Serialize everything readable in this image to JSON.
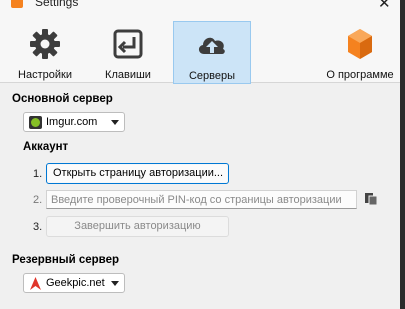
{
  "window": {
    "title": "Settings",
    "close_glyph": "✕"
  },
  "toolbar": {
    "items": [
      {
        "label": "Настройки",
        "icon": "gear-icon",
        "active": false
      },
      {
        "label": "Клавиши",
        "icon": "keyboard-return-icon",
        "active": false
      },
      {
        "label": "Серверы",
        "icon": "cloud-upload-icon",
        "active": true
      },
      {
        "label": "О программе",
        "icon": "app-logo-icon",
        "active": false
      }
    ]
  },
  "main_server": {
    "title": "Основной сервер",
    "selected": "Imgur.com",
    "icon": "imgur-icon"
  },
  "account": {
    "title": "Аккаунт",
    "steps": [
      {
        "num": "1.",
        "label": "Открыть страницу авторизации..."
      },
      {
        "num": "2.",
        "placeholder": "Введите проверочный PIN-код со страницы авторизации"
      },
      {
        "num": "3.",
        "label": "Завершить авторизацию"
      }
    ]
  },
  "backup_server": {
    "title": "Резервный сервер",
    "selected": "Geekpic.net",
    "icon": "geekpic-icon"
  },
  "colors": {
    "accent": "#0078d4",
    "active_tab_bg": "#cce4f7",
    "imgur_green": "#85bf25",
    "geekpic_red": "#e0352b",
    "logo_orange": "#f5821f"
  }
}
